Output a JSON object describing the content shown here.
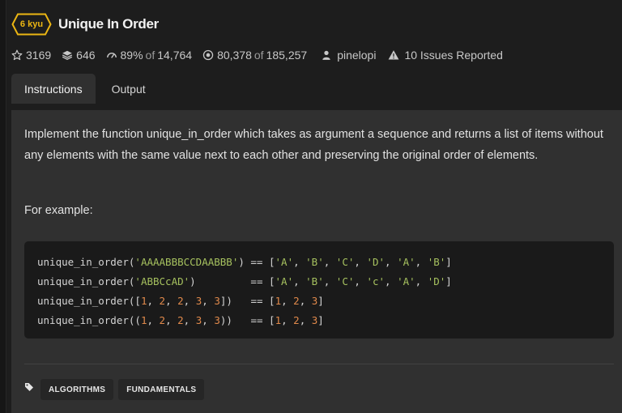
{
  "kata": {
    "rank": "6 kyu",
    "title": "Unique In Order",
    "rank_color": "#ecb613"
  },
  "stats": {
    "stars": "3169",
    "collections": "646",
    "satisfaction_percent": "89%",
    "satisfaction_of": "of",
    "satisfaction_total": "14,764",
    "completed": "80,378",
    "completed_of": "of",
    "completed_total": "185,257",
    "author": "pinelopi",
    "issues": "10 Issues Reported"
  },
  "icons": {
    "stars": "star-outline-icon",
    "collections": "stack-icon",
    "satisfaction": "speedometer-icon",
    "completed": "target-icon",
    "author": "user-icon",
    "issues": "warning-triangle-icon",
    "tags": "tag-icon"
  },
  "tabs": [
    {
      "label": "Instructions",
      "active": true
    },
    {
      "label": "Output",
      "active": false
    }
  ],
  "description": "Implement the function unique_in_order which takes as argument a sequence and returns a list of items without any elements with the same value next to each other and preserving the original order of elements.",
  "example_label": "For example:",
  "code_lines": [
    [
      {
        "t": "unique_in_order(",
        "c": "op"
      },
      {
        "t": "'AAAABBBCCDAABBB'",
        "c": "str"
      },
      {
        "t": ") == [",
        "c": "op"
      },
      {
        "t": "'A'",
        "c": "str"
      },
      {
        "t": ", ",
        "c": "op"
      },
      {
        "t": "'B'",
        "c": "str"
      },
      {
        "t": ", ",
        "c": "op"
      },
      {
        "t": "'C'",
        "c": "str"
      },
      {
        "t": ", ",
        "c": "op"
      },
      {
        "t": "'D'",
        "c": "str"
      },
      {
        "t": ", ",
        "c": "op"
      },
      {
        "t": "'A'",
        "c": "str"
      },
      {
        "t": ", ",
        "c": "op"
      },
      {
        "t": "'B'",
        "c": "str"
      },
      {
        "t": "]",
        "c": "op"
      }
    ],
    [
      {
        "t": "unique_in_order(",
        "c": "op"
      },
      {
        "t": "'ABBCcAD'",
        "c": "str"
      },
      {
        "t": ")         == [",
        "c": "op"
      },
      {
        "t": "'A'",
        "c": "str"
      },
      {
        "t": ", ",
        "c": "op"
      },
      {
        "t": "'B'",
        "c": "str"
      },
      {
        "t": ", ",
        "c": "op"
      },
      {
        "t": "'C'",
        "c": "str"
      },
      {
        "t": ", ",
        "c": "op"
      },
      {
        "t": "'c'",
        "c": "str"
      },
      {
        "t": ", ",
        "c": "op"
      },
      {
        "t": "'A'",
        "c": "str"
      },
      {
        "t": ", ",
        "c": "op"
      },
      {
        "t": "'D'",
        "c": "str"
      },
      {
        "t": "]",
        "c": "op"
      }
    ],
    [
      {
        "t": "unique_in_order([",
        "c": "op"
      },
      {
        "t": "1",
        "c": "num"
      },
      {
        "t": ", ",
        "c": "op"
      },
      {
        "t": "2",
        "c": "num"
      },
      {
        "t": ", ",
        "c": "op"
      },
      {
        "t": "2",
        "c": "num"
      },
      {
        "t": ", ",
        "c": "op"
      },
      {
        "t": "3",
        "c": "num"
      },
      {
        "t": ", ",
        "c": "op"
      },
      {
        "t": "3",
        "c": "num"
      },
      {
        "t": "])   == [",
        "c": "op"
      },
      {
        "t": "1",
        "c": "num"
      },
      {
        "t": ", ",
        "c": "op"
      },
      {
        "t": "2",
        "c": "num"
      },
      {
        "t": ", ",
        "c": "op"
      },
      {
        "t": "3",
        "c": "num"
      },
      {
        "t": "]",
        "c": "op"
      }
    ],
    [
      {
        "t": "unique_in_order((",
        "c": "op"
      },
      {
        "t": "1",
        "c": "num"
      },
      {
        "t": ", ",
        "c": "op"
      },
      {
        "t": "2",
        "c": "num"
      },
      {
        "t": ", ",
        "c": "op"
      },
      {
        "t": "2",
        "c": "num"
      },
      {
        "t": ", ",
        "c": "op"
      },
      {
        "t": "3",
        "c": "num"
      },
      {
        "t": ", ",
        "c": "op"
      },
      {
        "t": "3",
        "c": "num"
      },
      {
        "t": "))   == [",
        "c": "op"
      },
      {
        "t": "1",
        "c": "num"
      },
      {
        "t": ", ",
        "c": "op"
      },
      {
        "t": "2",
        "c": "num"
      },
      {
        "t": ", ",
        "c": "op"
      },
      {
        "t": "3",
        "c": "num"
      },
      {
        "t": "]",
        "c": "op"
      }
    ]
  ],
  "tags": [
    "ALGORITHMS",
    "FUNDAMENTALS"
  ],
  "colors": {
    "background": "#1d1d1d",
    "panel": "#303030",
    "code_background": "#1a1a1a",
    "string": "#a6c15f",
    "number": "#e0894b"
  }
}
